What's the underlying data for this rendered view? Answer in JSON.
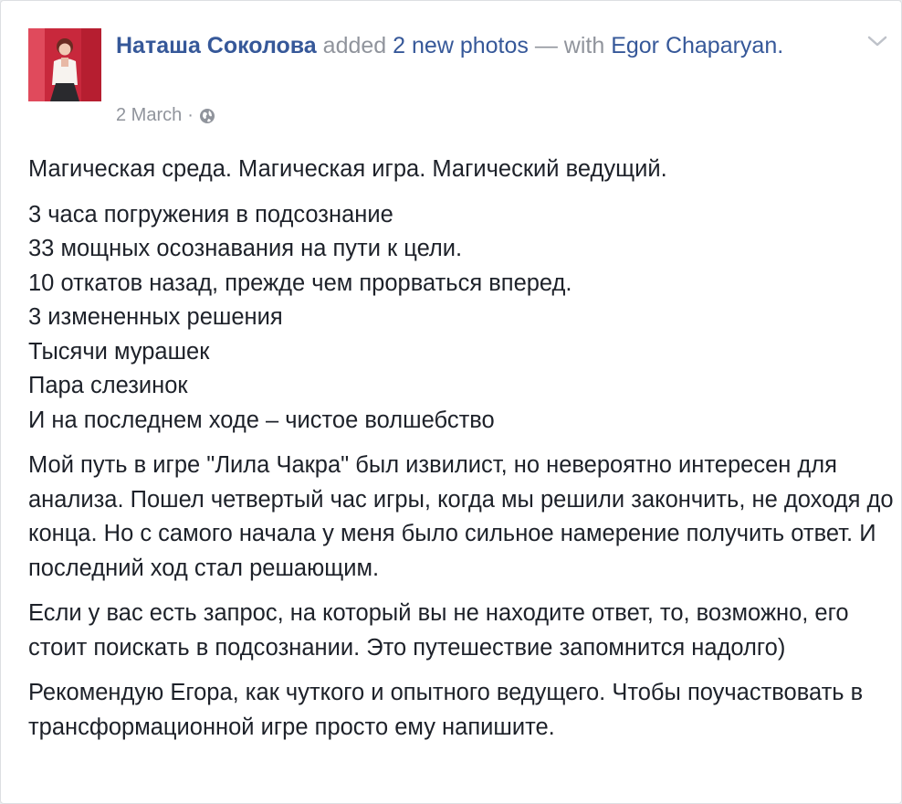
{
  "post": {
    "author": "Наташа Соколова",
    "action": "added",
    "photos_link": "2 new photos",
    "with_text": "— with",
    "tagged": "Egor Chaparyan",
    "after_tag": ".",
    "date": "2 March",
    "separator": "·",
    "privacy_icon": "globe-icon",
    "menu_icon": "chevron-down-icon"
  },
  "content": {
    "p1": "Магическая среда. Магическая игра. Магический ведущий.",
    "p2": "3 часа погружения в подсознание\n33 мощных осознавания на пути к цели.\n10 откатов назад, прежде чем прорваться вперед.\n3 измененных решения\nТысячи мурашек\nПара слезинок\nИ на последнем ходе – чистое волшебство",
    "p3": "Мой путь в игре \"Лила Чакра\" был извилист, но невероятно интересен для анализа. Пошел четвертый час игры, когда мы решили закончить, не доходя до конца. Но с самого начала у меня было сильное намерение получить ответ. И последний ход стал решающим.",
    "p4": "Если у вас есть запрос, на который вы не находите ответ, то, возможно, его стоит поискать в подсознании. Это путешествие запомнится надолго)",
    "p5": "Рекомендую Егора, как чуткого и опытного ведущего. Чтобы поучаствовать в трансформационной игре просто ему напишите."
  },
  "colors": {
    "link": "#365899",
    "meta": "#90949c",
    "text": "#1d2129"
  }
}
